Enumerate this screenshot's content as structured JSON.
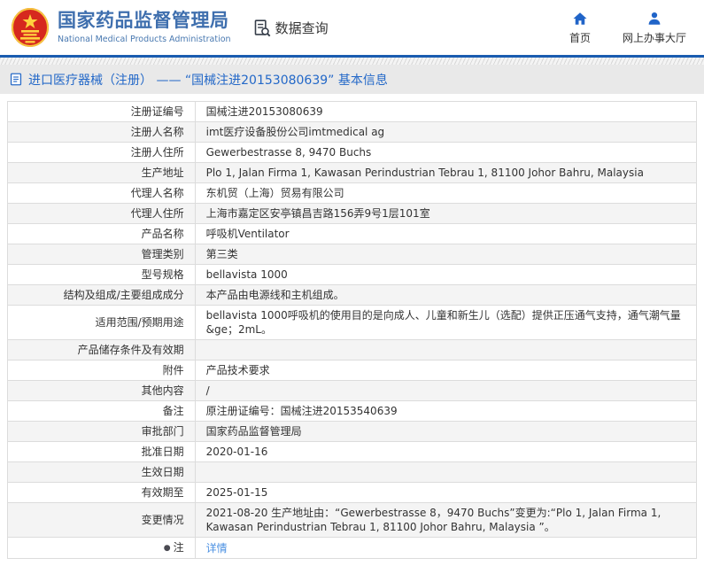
{
  "header": {
    "title_cn": "国家药品监督管理局",
    "title_en": "National Medical Products Administration",
    "data_query_label": "数据查询",
    "nav": [
      {
        "label": "首页",
        "icon": "home-icon"
      },
      {
        "label": "网上办事大厅",
        "icon": "person-icon"
      }
    ]
  },
  "breadcrumb": {
    "text": "进口医疗器械（注册） —— “国械注进20153080639” 基本信息",
    "icon": "document-icon"
  },
  "icons": {
    "logo": "national-emblem",
    "data_query": "document-search-icon",
    "note": "note-bullet-icon"
  },
  "colors": {
    "title_blue": "#3f6fae",
    "rule_blue": "#1a5cb0",
    "breadcrumb_blue": "#2368c8",
    "nav_icon_blue": "#2064c8",
    "link_blue": "#4a90e2",
    "alt_row_bg": "#f4f4f4",
    "emblem_red": "#d6281e",
    "emblem_gold": "#f6c63c"
  },
  "table": {
    "rows": [
      {
        "label": "注册证编号",
        "value": "国械注进20153080639"
      },
      {
        "label": "注册人名称",
        "value": "imt医疗设备股份公司imtmedical ag"
      },
      {
        "label": "注册人住所",
        "value": "Gewerbestrasse 8, 9470 Buchs"
      },
      {
        "label": "生产地址",
        "value": "Plo 1, Jalan Firma 1, Kawasan Perindustrian Tebrau 1, 81100 Johor Bahru, Malaysia"
      },
      {
        "label": "代理人名称",
        "value": "东机贸（上海）贸易有限公司"
      },
      {
        "label": "代理人住所",
        "value": "上海市嘉定区安亭镇昌吉路156弄9号1层101室"
      },
      {
        "label": "产品名称",
        "value": "呼吸机Ventilator"
      },
      {
        "label": "管理类别",
        "value": "第三类"
      },
      {
        "label": "型号规格",
        "value": "bellavista 1000"
      },
      {
        "label": "结构及组成/主要组成成分",
        "value": "本产品由电源线和主机组成。"
      },
      {
        "label": "适用范围/预期用途",
        "value": "bellavista 1000呼吸机的使用目的是向成人、儿童和新生儿（选配）提供正压通气支持，通气潮气量&ge；2mL。"
      },
      {
        "label": "产品储存条件及有效期",
        "value": ""
      },
      {
        "label": "附件",
        "value": "产品技术要求"
      },
      {
        "label": "其他内容",
        "value": "/"
      },
      {
        "label": "备注",
        "value": "原注册证编号：国械注进20153540639"
      },
      {
        "label": "审批部门",
        "value": "国家药品监督管理局"
      },
      {
        "label": "批准日期",
        "value": "2020-01-16"
      },
      {
        "label": "生效日期",
        "value": ""
      },
      {
        "label": "有效期至",
        "value": "2025-01-15"
      },
      {
        "label": "变更情况",
        "value": "2021-08-20 生产地址由：“Gewerbestrasse 8，9470 Buchs”变更为:“Plo 1, Jalan Firma 1, Kawasan Perindustrian Tebrau 1, 81100 Johor Bahru, Malaysia ”。"
      },
      {
        "label": "注",
        "value": "详情",
        "link": true,
        "note_icon": true
      }
    ]
  }
}
